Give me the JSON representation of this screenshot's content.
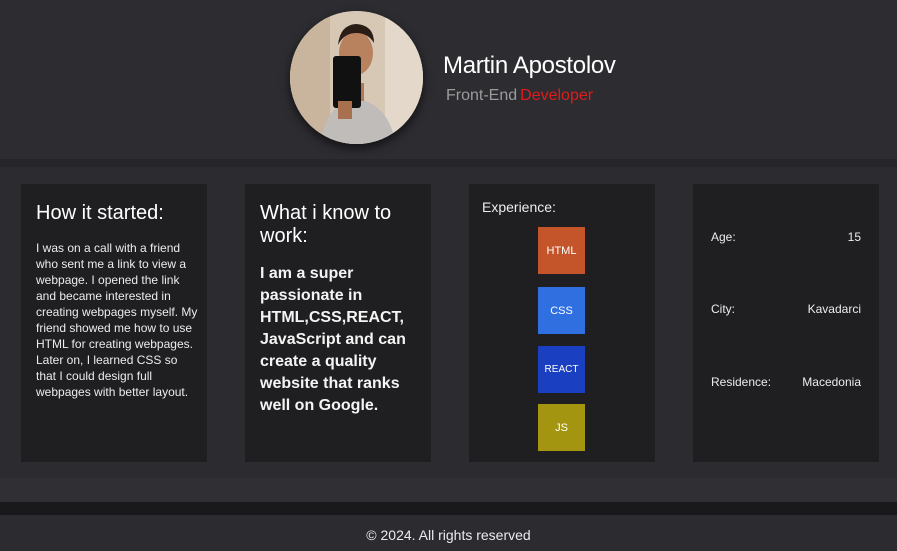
{
  "profile": {
    "name": "Martin Apostolov",
    "role_prefix": "Front-End",
    "role_accent": "Developer",
    "accent_color": "#e21b1b"
  },
  "cards": {
    "how_started": {
      "title": "How it started:",
      "text": "I was on a call with a friend who sent me a link to view a webpage. I opened the link and became interested in creating webpages myself. My friend showed me how to use HTML for creating webpages. Later on, I learned CSS so that I could design full webpages with better layout."
    },
    "knowledge": {
      "title": "What i know to work:",
      "text": "I am a super passionate in HTML,CSS,REACT, JavaScript and can create a quality website that ranks well on Google."
    },
    "experience": {
      "title": "Experience:",
      "skills": [
        {
          "label": "HTML",
          "color": "#c4552a"
        },
        {
          "label": "CSS",
          "color": "#2f6fe0"
        },
        {
          "label": "REACT",
          "color": "#1a3fc0"
        },
        {
          "label": "JS",
          "color": "#a3950f"
        }
      ]
    },
    "info": {
      "rows": [
        {
          "label": "Age:",
          "value": "15"
        },
        {
          "label": "City:",
          "value": "Kavadarci"
        },
        {
          "label": "Residence:",
          "value": "Macedonia"
        }
      ]
    }
  },
  "footer": {
    "text": "© 2024. All rights reserved"
  }
}
